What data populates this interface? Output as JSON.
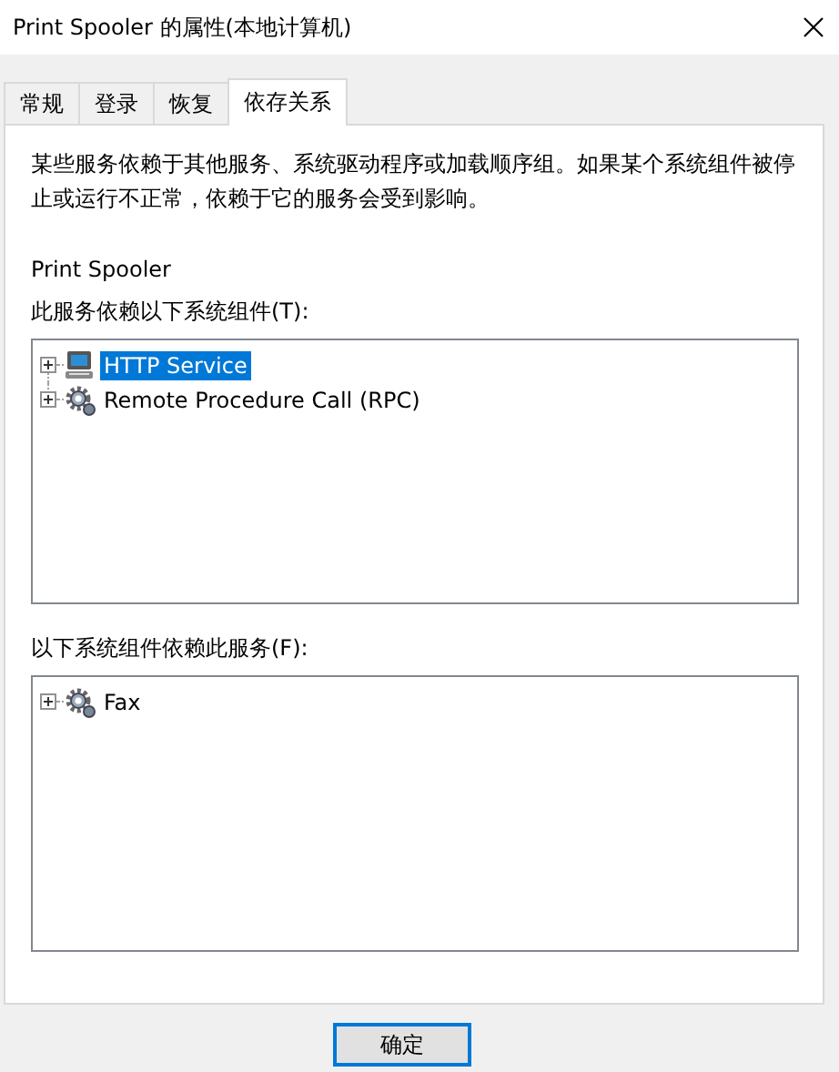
{
  "window": {
    "title": "Print Spooler 的属性(本地计算机)"
  },
  "tabs": [
    {
      "label": "常规",
      "selected": false
    },
    {
      "label": "登录",
      "selected": false
    },
    {
      "label": "恢复",
      "selected": false
    },
    {
      "label": "依存关系",
      "selected": true
    }
  ],
  "description": "某些服务依赖于其他服务、系统驱动程序或加载顺序组。如果某个系统组件被停止或运行不正常，依赖于它的服务会受到影响。",
  "service_name": "Print Spooler",
  "depends_on": {
    "label": "此服务依赖以下系统组件(T):",
    "items": [
      {
        "label": "HTTP Service",
        "kind": "computer",
        "selected": true,
        "expanded": false
      },
      {
        "label": "Remote Procedure Call (RPC)",
        "kind": "gear",
        "selected": false,
        "expanded": false
      }
    ]
  },
  "dependents": {
    "label": "以下系统组件依赖此服务(F):",
    "items": [
      {
        "label": "Fax",
        "kind": "gear",
        "selected": false,
        "expanded": false
      }
    ]
  },
  "buttons": [
    {
      "label": "确定",
      "default": true
    }
  ]
}
